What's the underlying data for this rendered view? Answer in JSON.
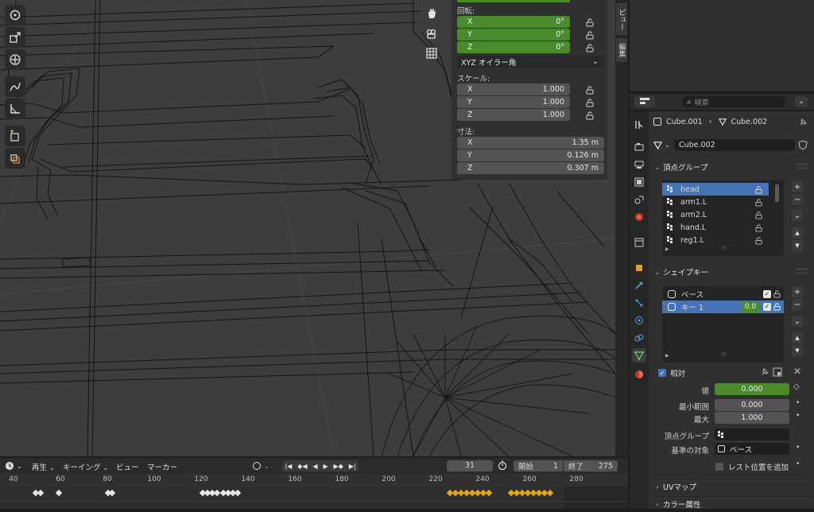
{
  "npanel": {
    "rotation_label": "回転:",
    "rotation": [
      {
        "axis": "X",
        "value": "0°"
      },
      {
        "axis": "Y",
        "value": "0°"
      },
      {
        "axis": "Z",
        "value": "0°"
      }
    ],
    "rotation_mode": "XYZ オイラー角",
    "scale_label": "スケール:",
    "scale": [
      {
        "axis": "X",
        "value": "1.000"
      },
      {
        "axis": "Y",
        "value": "1.000"
      },
      {
        "axis": "Z",
        "value": "1.000"
      }
    ],
    "dimensions_label": "寸法:",
    "dimensions": [
      {
        "axis": "X",
        "value": "1.35 m"
      },
      {
        "axis": "Y",
        "value": "0.126 m"
      },
      {
        "axis": "Z",
        "value": "0.307 m"
      }
    ]
  },
  "sidetabs": {
    "view": "ビュー",
    "edit": "編集"
  },
  "props": {
    "search_placeholder": "検索",
    "breadcrumb": {
      "object": "Cube.001",
      "mesh": "Cube.002"
    },
    "mesh_name": "Cube.002",
    "vertex_groups": {
      "title": "頂点グループ",
      "items": [
        "head",
        "arm1.L",
        "arm2.L",
        "hand.L",
        "reg1.L"
      ],
      "selected_index": 0
    },
    "shape_keys": {
      "title": "シェイプキー",
      "items": [
        {
          "name": "ベース",
          "value": ""
        },
        {
          "name": "キー 1",
          "value": "0.0"
        }
      ],
      "selected_index": 1,
      "relative_label": "相対",
      "value_label": "値",
      "value": "0.000",
      "range_min_label": "最小範囲",
      "range_min": "0.000",
      "max_label": "最大",
      "max": "1.000",
      "vertex_group_label": "頂点グループ",
      "reference_label": "基準の対象",
      "reference_value": "ベース",
      "add_rest_label": "レスト位置を追加"
    },
    "uv_maps_title": "UVマップ",
    "color_attributes_title": "カラー属性"
  },
  "timeline": {
    "menu": {
      "playback": "再生",
      "keying": "キーイング",
      "view": "ビュー",
      "marker": "マーカー"
    },
    "current_frame": "31",
    "start_label": "開始",
    "start": "1",
    "end_label": "終了",
    "end": "275",
    "ruler": [
      "40",
      "60",
      "80",
      "100",
      "120",
      "140",
      "160",
      "180",
      "200",
      "220",
      "240",
      "260",
      "280"
    ]
  },
  "colors": {
    "accent_green": "#4b8a2e",
    "selection_blue": "#4772b3",
    "keyframe_yellow": "#e6a417"
  }
}
